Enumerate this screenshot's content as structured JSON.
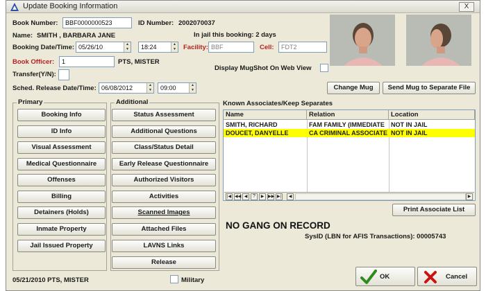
{
  "window": {
    "title": "Update Booking Information",
    "close_label": "X"
  },
  "booking": {
    "book_number_label": "Book Number:",
    "book_number": "BBF0000000523",
    "id_number_label": "ID Number:",
    "id_number": "2002070037",
    "name_label": "Name:",
    "name": "SMITH , BARBARA JANE",
    "in_jail_text": "In jail this booking: 2 days",
    "date_time_label": "Booking Date/Time:",
    "date": "05/26/10",
    "time": "18:24",
    "facility_label": "Facility:",
    "facility": "BBF",
    "cell_label": "Cell:",
    "cell": "FDT2",
    "officer_label": "Book Officer:",
    "officer_id": "1",
    "officer_name": "PTS, MISTER",
    "transfer_label": "Transfer(Y/N):",
    "transfer": "",
    "release_label": "Sched. Release Date/Time:",
    "release_date": "06/08/2012",
    "release_time": "09:00",
    "display_mugshot_label": "Display MugShot On Web View",
    "display_mugshot_checked": false
  },
  "buttons": {
    "change_mug": "Change Mug",
    "send_mug": "Send Mug to Separate File",
    "print_associates": "Print Associate List",
    "ok": "OK",
    "cancel": "Cancel"
  },
  "primary": {
    "title": "Primary",
    "items": [
      "Booking Info",
      "ID Info",
      "Visual Assessment",
      "Medical Questionnaire",
      "Offenses",
      "Billing",
      "Detainers (Holds)",
      "Inmate Property",
      "Jail Issued Property"
    ]
  },
  "additional": {
    "title": "Additional",
    "items": [
      "Status Assessment",
      "Additional Questions",
      "Class/Status Detail",
      "Early Release Questionnaire",
      "Authorized Visitors",
      "Activities",
      "Scanned Images",
      "Attached Files",
      "LAVNS Links",
      "Release"
    ]
  },
  "associates": {
    "title": "Known Associates/Keep Separates",
    "columns": [
      "Name",
      "Relation",
      "Location"
    ],
    "rows": [
      {
        "name": "SMITH, RICHARD",
        "relation": "FAM FAMILY (IMMEDIATE",
        "location": "NOT IN JAIL",
        "highlight": false
      },
      {
        "name": "DOUCET, DANYELLE",
        "relation": "CA CRIMINAL ASSOCIATE",
        "location": "NOT IN JAIL",
        "highlight": true
      }
    ],
    "highlight_color": "#ffff00"
  },
  "gang_text": "NO GANG ON RECORD",
  "sysid_text": "SysID (LBN for AFIS Transactions): 00005743",
  "footer": {
    "date_user": "05/21/2010  PTS, MISTER",
    "military_label": "Military",
    "military_checked": false
  },
  "colors": {
    "accent_red": "#b22222",
    "window_bg": "#ece9d8",
    "ok_check": "#2e8b1e",
    "cancel_x": "#cc1111"
  }
}
